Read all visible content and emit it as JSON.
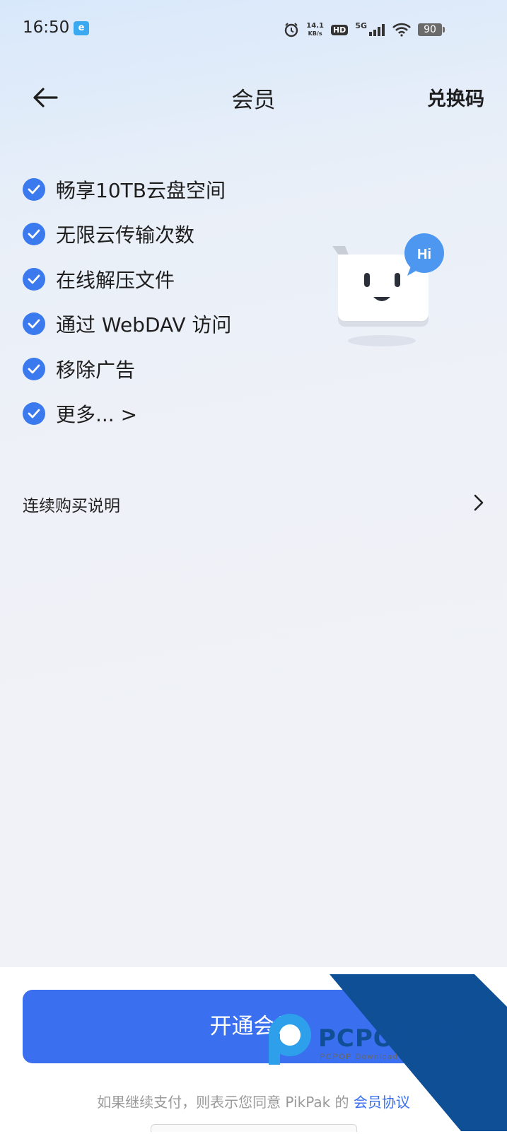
{
  "status_bar": {
    "time": "16:50",
    "app_badge": "e",
    "net_speed_value": "14.1",
    "net_speed_unit": "KB/s",
    "hd": "HD",
    "network": "5G",
    "battery": "90"
  },
  "header": {
    "title": "会员",
    "redeem_label": "兑换码"
  },
  "benefits": {
    "items": [
      "畅享10TB云盘空间",
      "无限云传输次数",
      "在线解压文件",
      "通过 WebDAV 访问",
      "移除广告",
      "更多... >"
    ]
  },
  "mascot": {
    "bubble_text": "Hi"
  },
  "purchase_notes": {
    "label": "连续购买说明"
  },
  "footer": {
    "subscribe_label": "开通会员",
    "agreement_prefix": "如果继续支付，则表示您同意 PikPak 的 ",
    "agreement_link": "会员协议"
  },
  "watermark": {
    "brand": "PCPOP下载",
    "sub": "PCPOP Download"
  },
  "colors": {
    "accent": "#3a6ff0",
    "check": "#3a79ee"
  }
}
